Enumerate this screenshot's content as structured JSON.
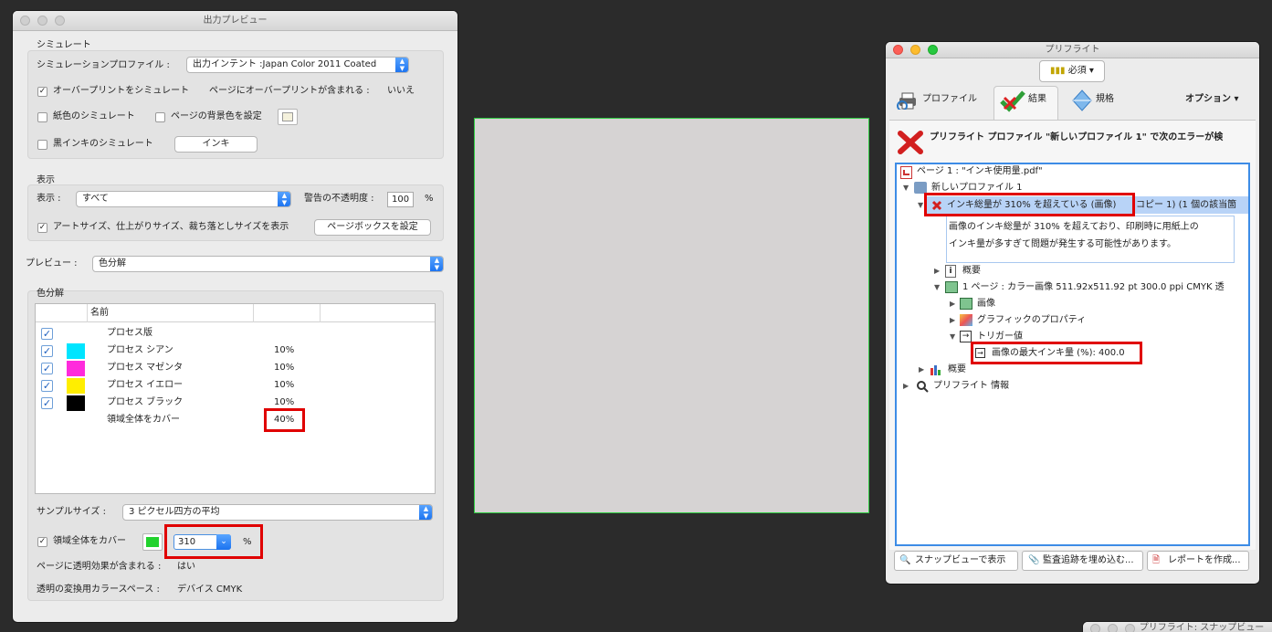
{
  "left_window": {
    "title": "出力プレビュー",
    "simulate": {
      "heading": "シミュレート",
      "profile_label": "シミュレーションプロファイル :",
      "profile_value": "出力インテント :Japan Color 2011 Coated",
      "overprint_label": "オーバープリントをシミュレート",
      "overprint_checked": "✓",
      "page_overprint_label": "ページにオーバープリントが含まれる :",
      "page_overprint_value": "いいえ",
      "paper_label": "紙色のシミュレート",
      "page_bg_label": "ページの背景色を設定",
      "black_ink_label": "黒インキのシミュレート",
      "ink_button": "インキ"
    },
    "display": {
      "heading": "表示",
      "show_label": "表示 :",
      "show_value": "すべて",
      "opacity_label": "警告の不透明度 :",
      "opacity_value": "100",
      "opacity_unit": "%",
      "boxes_label": "アートサイズ、仕上がりサイズ、裁ち落としサイズを表示",
      "boxes_checked": "✓",
      "page_box_button": "ページボックスを設定"
    },
    "preview": {
      "label": "プレビュー :",
      "value": "色分解"
    },
    "separations": {
      "heading": "色分解",
      "column_name": "名前",
      "rows": [
        {
          "name": "プロセス版",
          "percent": "",
          "color": ""
        },
        {
          "name": "プロセス シアン",
          "percent": "10%",
          "color": "#00e5ff"
        },
        {
          "name": "プロセス マゼンタ",
          "percent": "10%",
          "color": "#ff2bdc"
        },
        {
          "name": "プロセス イエロー",
          "percent": "10%",
          "color": "#ffee00"
        },
        {
          "name": "プロセス ブラック",
          "percent": "10%",
          "color": "#000000"
        }
      ],
      "total_label": "領域全体をカバー",
      "total_value": "40%",
      "check_mark": "✓"
    },
    "sample": {
      "label": "サンプルサイズ :",
      "value": "3 ピクセル四方の平均"
    },
    "coverage": {
      "label": "領域全体をカバー",
      "checked": "✓",
      "swatch_color": "#22d22e",
      "value": "310",
      "unit": "%"
    },
    "transparency": {
      "label": "ページに透明効果が含まれる :",
      "value": "はい"
    },
    "blend_space": {
      "label": "透明の変換用カラースペース :",
      "value": "デバイス CMYK"
    }
  },
  "preflight": {
    "title": "プリフライト",
    "required_button": "必須",
    "tabs": {
      "profile": "プロファイル",
      "results": "結果",
      "standards": "規格",
      "options": "オプション"
    },
    "message": "プリフライト プロファイル \"新しいプロファイル 1\" で次のエラーが検",
    "tree": {
      "page": "ページ 1 : \"インキ使用量.pdf\"",
      "profile": "新しいプロファイル 1",
      "error_title": "インキ総量が 310% を超えている (画像)",
      "error_suffix": "コピー 1) (1 個の該当箇",
      "description_1": "画像のインキ総量が 310% を超えており、印刷時に用紙上の",
      "description_2": "インキ量が多すぎて問題が発生する可能性があります。",
      "overview_1": "概要",
      "image_item": "1 ページ : カラー画像 511.92x511.92 pt 300.0 ppi CMYK 透",
      "image": "画像",
      "graphic_props": "グラフィックのプロパティ",
      "trigger": "トリガー値",
      "trigger_value": "画像の最大インキ量 (%): 400.0",
      "overview_2": "概要",
      "preflight_info": "プリフライト 情報"
    },
    "buttons": {
      "snap": "スナップビューで表示",
      "audit": "監査追跡を埋め込む...",
      "report": "レポートを作成..."
    }
  },
  "snap_window": {
    "title": "プリフライト: スナップビュー"
  }
}
